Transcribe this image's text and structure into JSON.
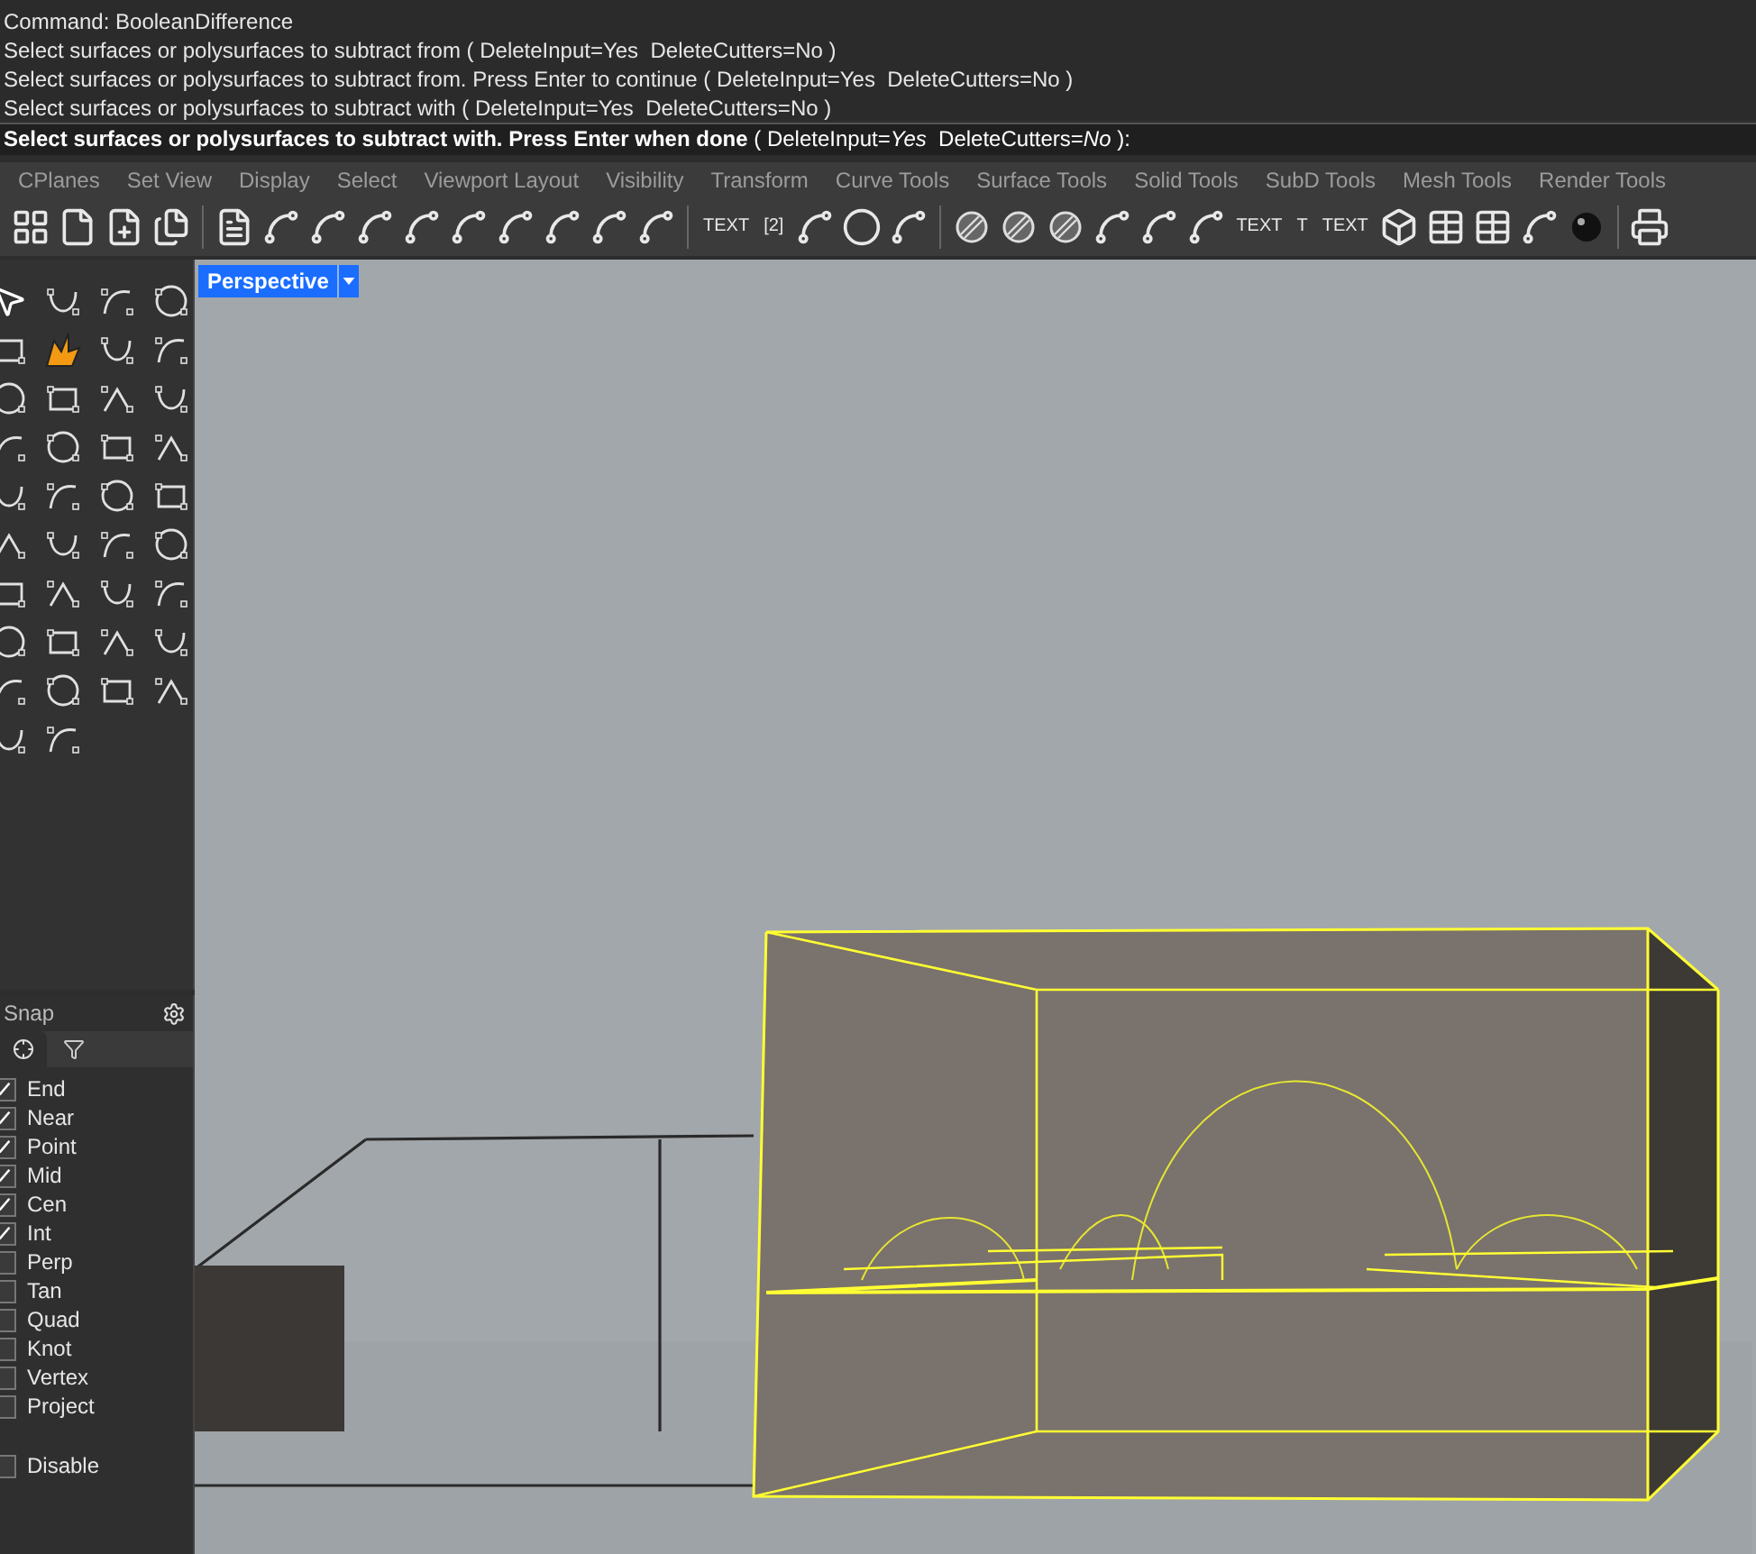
{
  "command_history": [
    "Command: BooleanDifference",
    "Select surfaces or polysurfaces to subtract from ( DeleteInput=Yes  DeleteCutters=No )",
    "Select surfaces or polysurfaces to subtract from. Press Enter to continue ( DeleteInput=Yes  DeleteCutters=No )",
    "Select surfaces or polysurfaces to subtract with ( DeleteInput=Yes  DeleteCutters=No )"
  ],
  "command_prompt": "**Select surfaces or polysurfaces to subtract with. Press Enter when done** ( DeleteInput=*Yes*  DeleteCutters=*No* ):",
  "toolbar_tabs": [
    "CPlanes",
    "Set View",
    "Display",
    "Select",
    "Viewport Layout",
    "Visibility",
    "Transform",
    "Curve Tools",
    "Surface Tools",
    "Solid Tools",
    "SubD Tools",
    "Mesh Tools",
    "Render Tools"
  ],
  "toolbar": [
    {
      "kind": "layout"
    },
    {
      "kind": "page"
    },
    {
      "kind": "page-add"
    },
    {
      "kind": "page-copy"
    },
    {
      "kind": "sep"
    },
    {
      "kind": "doc"
    },
    {
      "kind": "dim"
    },
    {
      "kind": "dim"
    },
    {
      "kind": "dim"
    },
    {
      "kind": "dim"
    },
    {
      "kind": "dim"
    },
    {
      "kind": "dim"
    },
    {
      "kind": "dim"
    },
    {
      "kind": "dim"
    },
    {
      "kind": "dim"
    },
    {
      "kind": "sep"
    },
    {
      "kind": "text",
      "label": "TEXT"
    },
    {
      "kind": "text",
      "label": "[2]"
    },
    {
      "kind": "dim"
    },
    {
      "kind": "circle"
    },
    {
      "kind": "dim"
    },
    {
      "kind": "sep"
    },
    {
      "kind": "hatch"
    },
    {
      "kind": "hatch"
    },
    {
      "kind": "hatch"
    },
    {
      "kind": "dim"
    },
    {
      "kind": "dim"
    },
    {
      "kind": "dim"
    },
    {
      "kind": "text",
      "label": "TEXT"
    },
    {
      "kind": "text",
      "label": "T"
    },
    {
      "kind": "text",
      "label": "TEXT"
    },
    {
      "kind": "cube"
    },
    {
      "kind": "table"
    },
    {
      "kind": "table"
    },
    {
      "kind": "dim"
    },
    {
      "kind": "sphere"
    },
    {
      "kind": "sep"
    },
    {
      "kind": "printer"
    }
  ],
  "viewport": {
    "label": "Perspective"
  },
  "osnap": {
    "title": "Snap",
    "items": [
      {
        "label": "End",
        "checked": true
      },
      {
        "label": "Near",
        "checked": true
      },
      {
        "label": "Point",
        "checked": true
      },
      {
        "label": "Mid",
        "checked": true
      },
      {
        "label": "Cen",
        "checked": true
      },
      {
        "label": "Int",
        "checked": true
      },
      {
        "label": "Perp",
        "checked": false
      },
      {
        "label": "Tan",
        "checked": false
      },
      {
        "label": "Quad",
        "checked": false
      },
      {
        "label": "Knot",
        "checked": false
      },
      {
        "label": "Vertex",
        "checked": false
      },
      {
        "label": "Project",
        "checked": false
      }
    ],
    "disable": {
      "label": "Disable",
      "checked": false
    }
  }
}
